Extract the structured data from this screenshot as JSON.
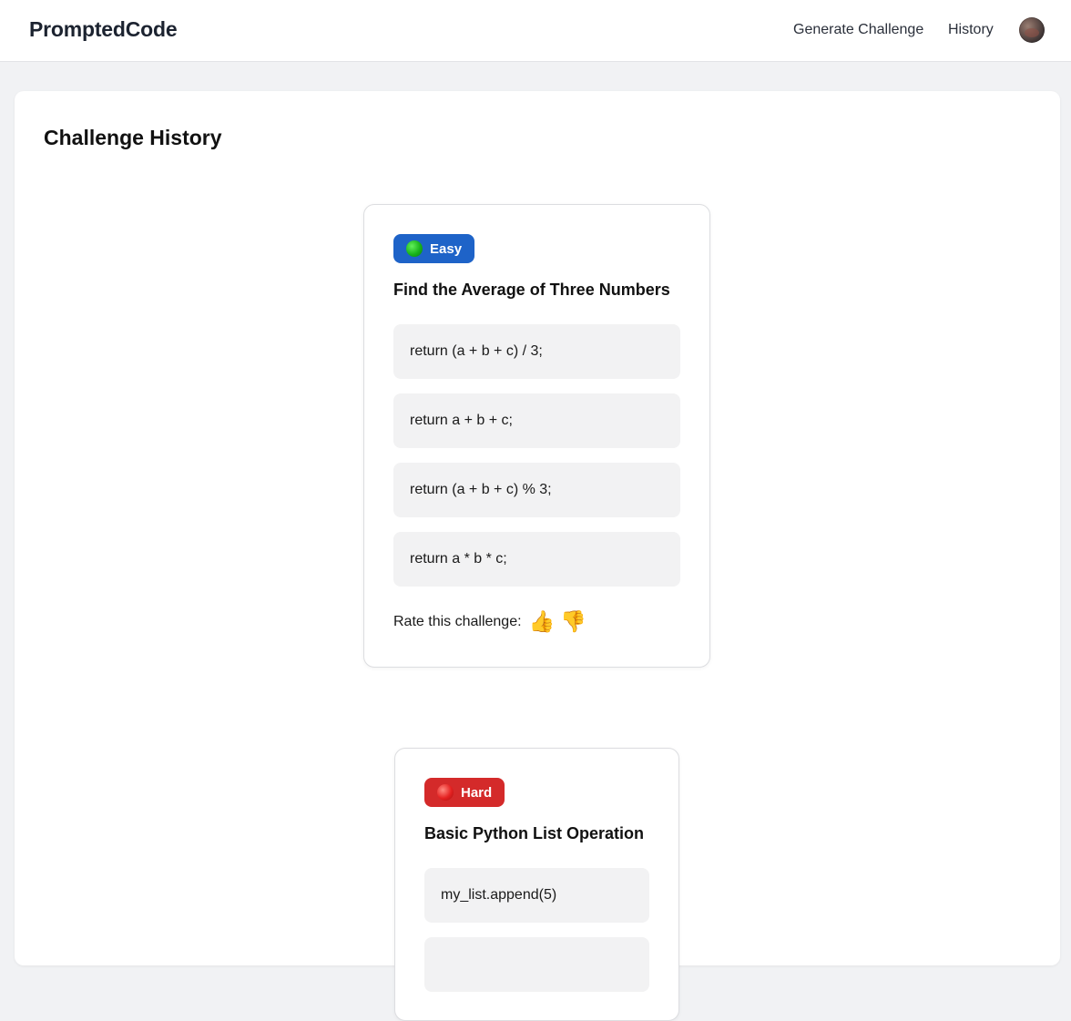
{
  "header": {
    "brand": "PromptedCode",
    "nav": {
      "generate": "Generate Challenge",
      "history": "History"
    }
  },
  "page": {
    "title": "Challenge History"
  },
  "challenges": [
    {
      "difficulty": "Easy",
      "difficulty_color": "#1e63c8",
      "title": "Find the Average of Three Numbers",
      "options": [
        "return (a + b + c) / 3;",
        "return a + b + c;",
        "return (a + b + c) % 3;",
        "return a * b * c;"
      ],
      "rating_label": "Rate this challenge:",
      "thumbs_up": "👍",
      "thumbs_down": "👎"
    },
    {
      "difficulty": "Hard",
      "difficulty_color": "#d42a2a",
      "title": "Basic Python List Operation",
      "options": [
        "my_list.append(5)"
      ]
    }
  ],
  "colors": {
    "background": "#f1f2f4",
    "option_bg": "#f2f2f3",
    "easy": "#1e63c8",
    "hard": "#d42a2a"
  },
  "icons": {
    "easy_dot": "green-circle-icon",
    "hard_dot": "red-circle-icon",
    "thumbs_up": "thumbs-up-icon",
    "thumbs_down": "thumbs-down-icon",
    "avatar": "user-avatar"
  }
}
